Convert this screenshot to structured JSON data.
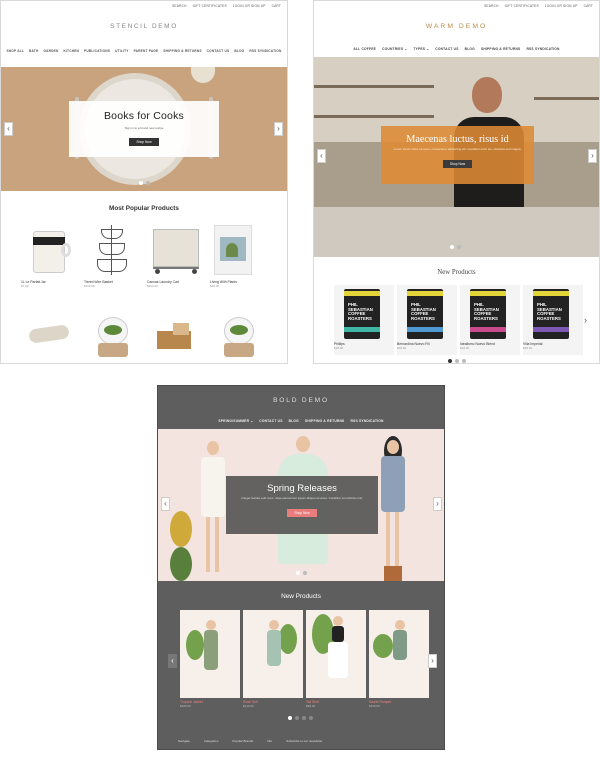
{
  "stencil": {
    "utility": [
      "Search",
      "Gift Certificates",
      "Login or Sign Up",
      "Cart"
    ],
    "logo": "Stencil Demo",
    "nav": [
      "Shop All",
      "Bath",
      "Garden",
      "Kitchen",
      "Publications",
      "Utility",
      "Parent Page",
      "Shipping & Returns",
      "Contact Us",
      "Blog",
      "RSS Syndication"
    ],
    "hero": {
      "title": "Books for Cooks",
      "subtitle": "Sign in to a brand new recipe",
      "button": "Shop Now"
    },
    "section_title": "Most Popular Products",
    "products": [
      {
        "name": "1L Le Parfait Jar",
        "price": "$7.00"
      },
      {
        "name": "Tiered Wire Basket",
        "price": "$119.95"
      },
      {
        "name": "Canvas Laundry Cart",
        "price": "$200.00"
      },
      {
        "name": "Living With Plants",
        "price": "$26.00"
      }
    ]
  },
  "warm": {
    "utility": [
      "Search",
      "Gift Certificates",
      "Login or Sign Up",
      "Cart"
    ],
    "logo": "Warm Demo",
    "nav": [
      "All Coffee",
      "Countries",
      "Types",
      "Contact Us",
      "Blog",
      "Shipping & Returns",
      "RSS Syndication"
    ],
    "hero": {
      "title": "Maecenas luctus, risus id",
      "subtitle": "Lorem ipsum dolor sit amet, consectetur adipiscing elit. Curabitur enim leo, pharetra sed magna.",
      "button": "Shop Now"
    },
    "section_title": "New Products",
    "bag_text": "PHIL SEBASTIAN COFFEE ROASTERS",
    "products": [
      {
        "name": "Phillips",
        "price": "$18.00"
      },
      {
        "name": "Bernardina Nuevo Fili",
        "price": "$18.00"
      },
      {
        "name": "Idealismo Nuevo Blend",
        "price": "$18.00"
      },
      {
        "name": "Villa Imperial",
        "price": "$18.00"
      }
    ]
  },
  "bold": {
    "logo": "Bold Demo",
    "nav": [
      "Spring/Summer",
      "Contact Us",
      "Blog",
      "Shipping & Returns",
      "RSS Syndication"
    ],
    "hero": {
      "title": "Spring Releases",
      "subtitle": "Integer lacinia velit nunc, vitae elementum ipsum aliquet sit amet. Curabitur vel ultricies nisl.",
      "button": "Shop Now"
    },
    "section_title": "New Products",
    "products": [
      {
        "name": "Tropical Jacket",
        "price": "$180.00"
      },
      {
        "name": "Rose Suit",
        "price": "$210.00"
      },
      {
        "name": "Tall Skirt",
        "price": "$98.00"
      },
      {
        "name": "Sweet Romper",
        "price": "$150.00"
      }
    ],
    "footer": [
      "Navigate",
      "Categories",
      "Popular Brands",
      "Info",
      "Subscribe to our newsletter"
    ]
  },
  "colors": {
    "stencil_hero": "#c9a27e",
    "warm_accent": "#de8b34",
    "bold_bg": "#5e5e5e",
    "bold_button": "#e87d7b",
    "bold_hero": "#f3e4df"
  },
  "icons": [
    "chevron-left-icon",
    "chevron-right-icon"
  ]
}
